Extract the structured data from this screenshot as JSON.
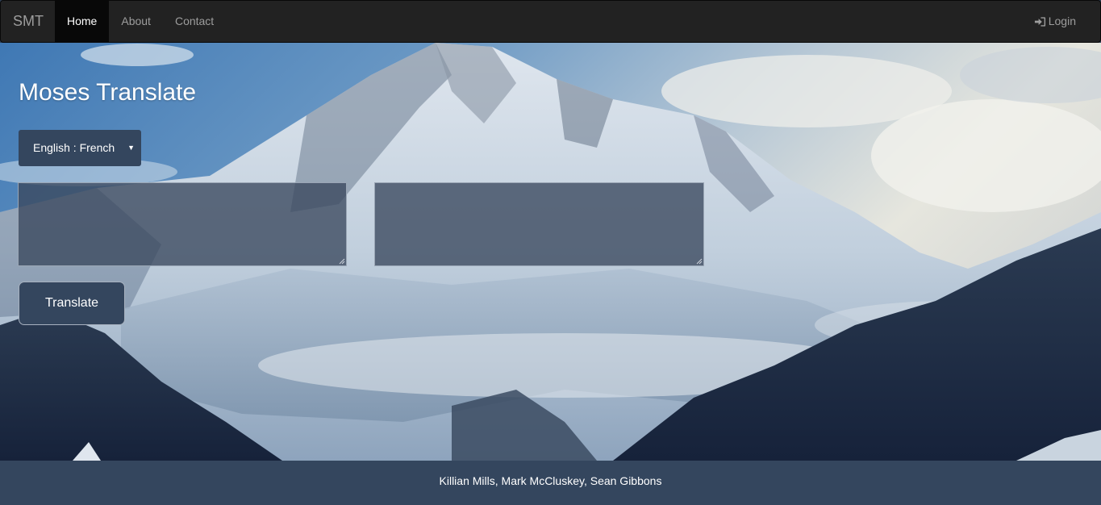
{
  "navbar": {
    "brand": "SMT",
    "links": [
      {
        "label": "Home",
        "active": true
      },
      {
        "label": "About",
        "active": false
      },
      {
        "label": "Contact",
        "active": false
      }
    ],
    "login_label": "Login",
    "login_icon": "login-icon"
  },
  "hero": {
    "title": "Moses Translate",
    "language_select": {
      "selected": "English : French"
    },
    "source_text": {
      "value": ""
    },
    "target_text": {
      "value": ""
    },
    "translate_label": "Translate"
  },
  "footer": {
    "credits": "Killian Mills, Mark McCluskey, Sean Gibbons"
  },
  "colors": {
    "navbar_bg": "#222222",
    "navbar_active": "#080808",
    "accent_panel": "#34465e",
    "footer_bg": "#34465e"
  }
}
